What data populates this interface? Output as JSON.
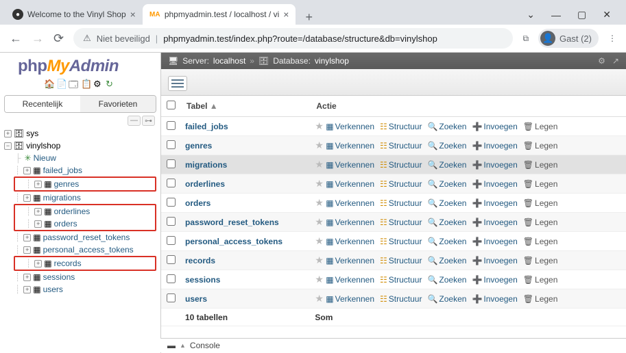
{
  "browser": {
    "tabs": [
      {
        "title": "Welcome to the Vinyl Shop",
        "favicon_bg": "#333",
        "favicon_text": "●"
      },
      {
        "title": "phpmyadmin.test / localhost / vi",
        "favicon_bg": "#fff",
        "favicon_text": "🛦"
      }
    ],
    "security_text": "Niet beveiligd",
    "url": "phpmyadmin.test/index.php?route=/database/structure&db=vinylshop",
    "profile": "Gast (2)"
  },
  "logo": {
    "p1": "php",
    "p2": "My",
    "p3": "Admin"
  },
  "side_tabs": {
    "recent": "Recentelijk",
    "fav": "Favorieten"
  },
  "breadcrumb": {
    "server_label": "Server:",
    "server": "localhost",
    "db_label": "Database:",
    "db": "vinylshop"
  },
  "tree": {
    "sys": "sys",
    "vinylshop": "vinylshop",
    "new": "Nieuw",
    "tables": [
      "failed_jobs",
      "genres",
      "migrations",
      "orderlines",
      "orders",
      "password_reset_tokens",
      "personal_access_tokens",
      "records",
      "sessions",
      "users"
    ],
    "highlighted": [
      "genres",
      "orderlines",
      "orders",
      "records"
    ]
  },
  "headers": {
    "table": "Tabel",
    "action": "Actie"
  },
  "actions": {
    "browse": "Verkennen",
    "structure": "Structuur",
    "search": "Zoeken",
    "insert": "Invoegen",
    "empty": "Legen"
  },
  "tables": [
    "failed_jobs",
    "genres",
    "migrations",
    "orderlines",
    "orders",
    "password_reset_tokens",
    "personal_access_tokens",
    "records",
    "sessions",
    "users"
  ],
  "summary": {
    "count": "10 tabellen",
    "sum": "Som"
  },
  "console": "Console"
}
